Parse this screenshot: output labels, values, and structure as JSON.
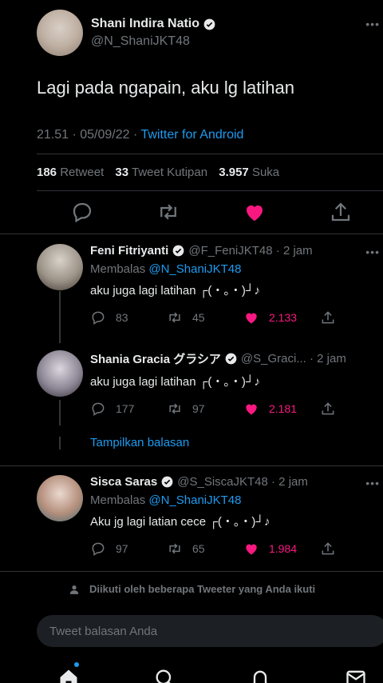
{
  "main_tweet": {
    "author_name": "Shani Indira Natio",
    "author_handle": "@N_ShaniJKT48",
    "text": "Lagi pada ngapain, aku lg latihan",
    "time": "21.51 · 05/09/22 · ",
    "source": "Twitter for Android",
    "stats": {
      "retweets": "186",
      "retweets_label": "Retweet",
      "quotes": "33",
      "quotes_label": "Tweet Kutipan",
      "likes": "3.957",
      "likes_label": "Suka"
    }
  },
  "replies": [
    {
      "name": "Feni Fitriyanti",
      "handle_time": "@F_FeniJKT48 · 2 jam",
      "replying_prefix": "Membalas ",
      "replying_handle": "@N_ShaniJKT48",
      "text": "aku juga lagi latihan ┌(・。・)┘♪",
      "replies": "83",
      "retweets": "45",
      "likes": "2.133"
    },
    {
      "name": "Shania Gracia グラシア",
      "handle_time": "@S_Graci... · 2 jam",
      "text": "aku juga lagi latihan  ┌(・。・)┘♪",
      "replies": "177",
      "retweets": "97",
      "likes": "2.181"
    },
    {
      "name": "Sisca Saras",
      "handle_time": "@S_SiscaJKT48 · 2 jam",
      "replying_prefix": "Membalas ",
      "replying_handle": "@N_ShaniJKT48",
      "text": "Aku jg lagi latian cece ┌(・。・)┘♪",
      "replies": "97",
      "retweets": "65",
      "likes": "1.984"
    }
  ],
  "show_replies_label": "Tampilkan balasan",
  "followed_notice": "Diikuti oleh beberapa Tweeter yang Anda ikuti",
  "reply_input": {
    "placeholder": "Tweet balasan Anda"
  },
  "colors": {
    "background": "#000000",
    "accent": "#1d9bf0",
    "like": "#f91880",
    "muted": "#71767b"
  },
  "icons": [
    "verified-badge-icon",
    "reply-icon",
    "retweet-icon",
    "like-icon-filled",
    "share-icon",
    "more-icon",
    "person-icon",
    "home-icon",
    "search-icon",
    "notifications-icon",
    "messages-icon"
  ]
}
